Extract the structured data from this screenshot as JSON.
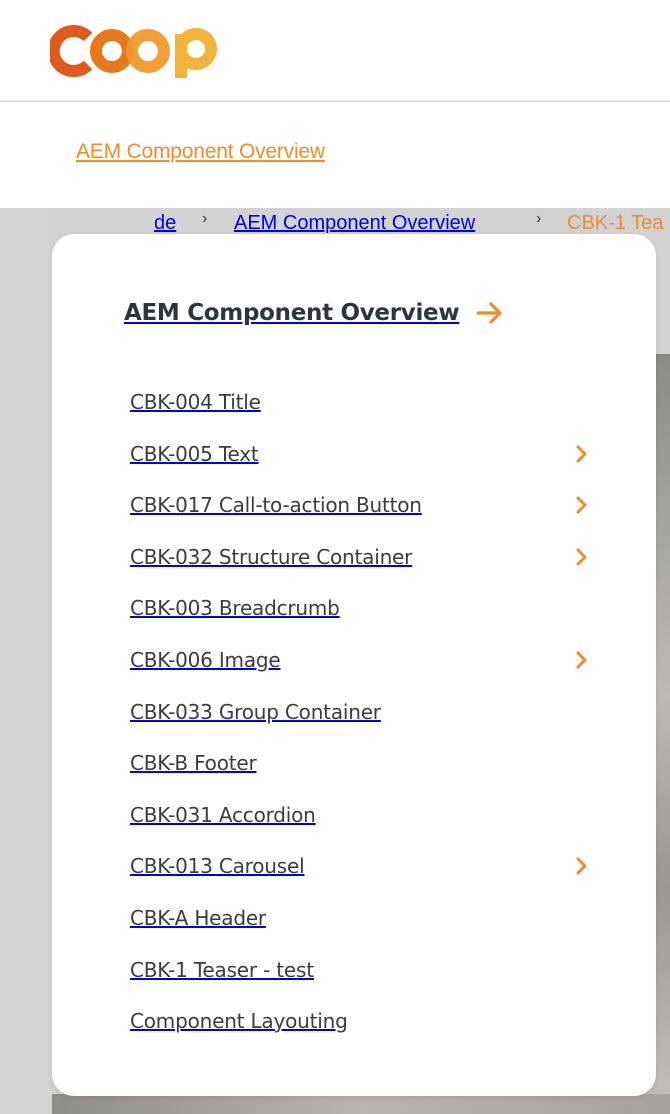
{
  "brand": {
    "logo_text": "coop",
    "accent": "#ef8d2c",
    "text": "#3c3c3c"
  },
  "subnav": {
    "link_label": "AEM Component Overview"
  },
  "breadcrumb": {
    "items": [
      "de",
      "AEM Component Overview",
      "CBK-1 Tea"
    ],
    "separator": "›"
  },
  "menu": {
    "title": "AEM Component Overview",
    "title_icon": "arrow-right-icon",
    "items": [
      {
        "label": "CBK-004 Title",
        "has_children": false
      },
      {
        "label": "CBK-005 Text",
        "has_children": true
      },
      {
        "label": "CBK-017 Call-to-action Button",
        "has_children": true
      },
      {
        "label": "CBK-032 Structure Container",
        "has_children": true
      },
      {
        "label": "CBK-003 Breadcrumb",
        "has_children": false
      },
      {
        "label": "CBK-006 Image",
        "has_children": true
      },
      {
        "label": "CBK-033 Group Container",
        "has_children": false
      },
      {
        "label": "CBK-B Footer",
        "has_children": false
      },
      {
        "label": "CBK-031 Accordion",
        "has_children": false
      },
      {
        "label": "CBK-013 Carousel",
        "has_children": true
      },
      {
        "label": "CBK-A Header",
        "has_children": false
      },
      {
        "label": "CBK-1 Teaser - test",
        "has_children": false
      },
      {
        "label": "Component Layouting",
        "has_children": false
      }
    ]
  }
}
